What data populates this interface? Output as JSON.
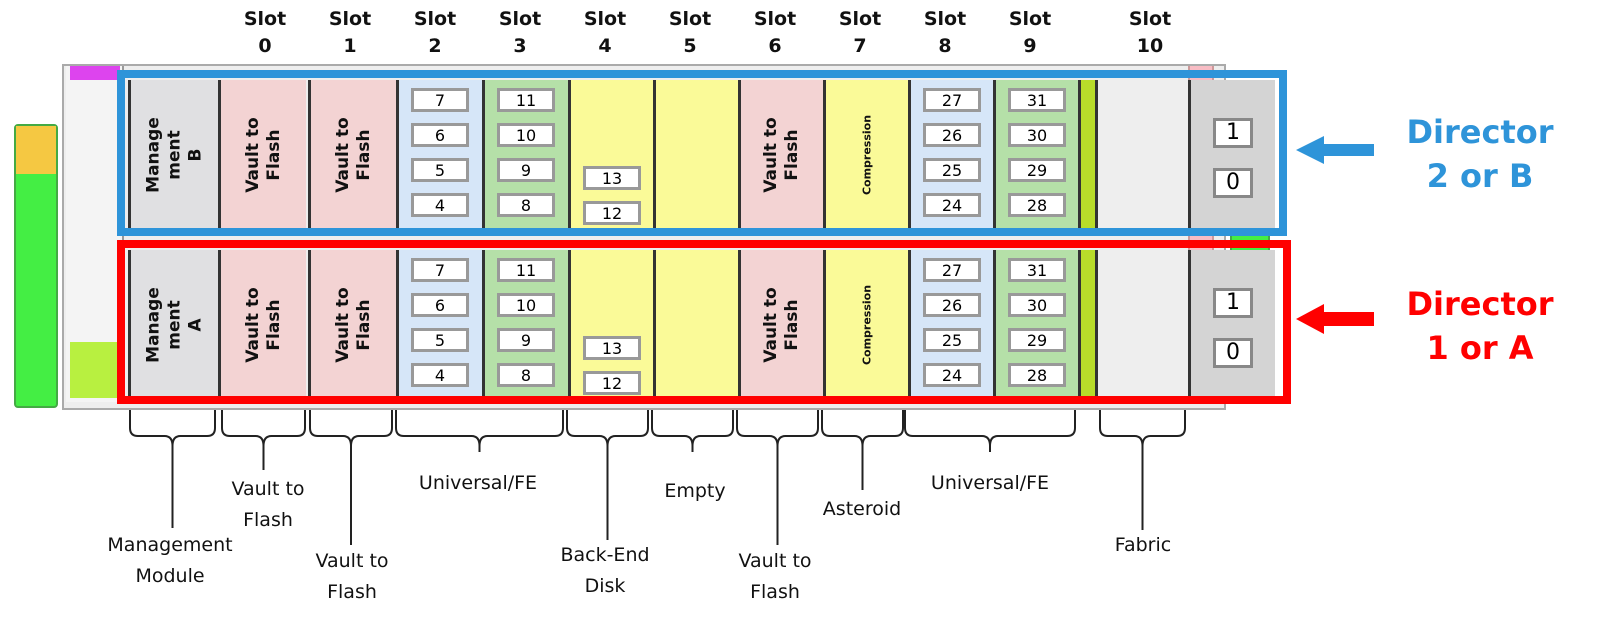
{
  "slot_word": "Slot",
  "slots": [
    {
      "n": "0",
      "type": "vault",
      "label": "Vault to\nFlash"
    },
    {
      "n": "1",
      "type": "vault",
      "label": "Vault to\nFlash"
    },
    {
      "n": "2",
      "type": "io-blue",
      "ports": [
        "7",
        "6",
        "5",
        "4"
      ]
    },
    {
      "n": "3",
      "type": "io-green",
      "ports": [
        "11",
        "10",
        "9",
        "8"
      ]
    },
    {
      "n": "4",
      "type": "be",
      "ports": [
        "13",
        "12"
      ]
    },
    {
      "n": "5",
      "type": "empty"
    },
    {
      "n": "6",
      "type": "vault",
      "label": "Vault to\nFlash"
    },
    {
      "n": "7",
      "type": "compression",
      "label": "Compression"
    },
    {
      "n": "8",
      "type": "io-blue",
      "ports": [
        "27",
        "26",
        "25",
        "24"
      ]
    },
    {
      "n": "9",
      "type": "io-green",
      "ports": [
        "31",
        "30",
        "29",
        "28"
      ]
    },
    {
      "n": "10",
      "type": "fabric",
      "ports": [
        "1",
        "0"
      ]
    }
  ],
  "management": {
    "B": "Manage\nment\nB",
    "A": "Manage\nment\nA"
  },
  "directors": {
    "b": {
      "line1": "Director",
      "line2": "2 or B",
      "color": "#2e94d9"
    },
    "a": {
      "line1": "Director",
      "line2": "1 or A",
      "color": "#ff0000"
    }
  },
  "colors": {
    "mgmt": "#e0e0e2",
    "vault": "#f3d3d3",
    "io-blue": "#d6e6f8",
    "io-green": "#b5e0a8",
    "be": "#fafa98",
    "empty": "#fafa98",
    "compression": "#fafa98",
    "fabric": "#d4d4d4"
  },
  "labels": [
    {
      "text": "Management\nModule"
    },
    {
      "text": "Vault to\nFlash"
    },
    {
      "text": "Vault to\nFlash"
    },
    {
      "text": "Universal/FE"
    },
    {
      "text": "Back-End\nDisk"
    },
    {
      "text": "Empty"
    },
    {
      "text": "Vault to\nFlash"
    },
    {
      "text": "Asteroid"
    },
    {
      "text": "Universal/FE"
    },
    {
      "text": "Fabric"
    }
  ]
}
